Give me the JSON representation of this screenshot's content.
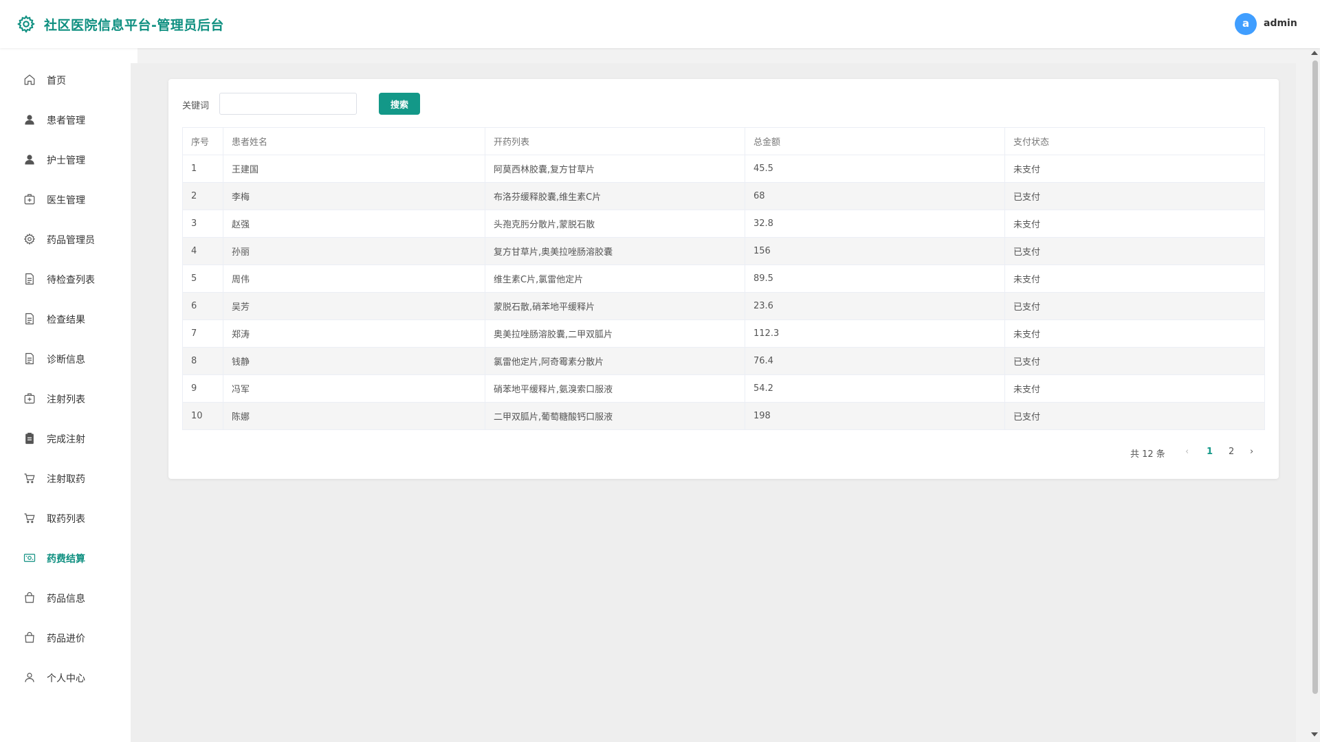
{
  "header": {
    "title": "社区医院信息平台-管理员后台",
    "avatar_letter": "a",
    "username": "admin"
  },
  "colors": {
    "accent": "#0e8f80",
    "button": "#139888",
    "avatar": "#409eff"
  },
  "sidebar": {
    "items": [
      {
        "label": "首页",
        "icon": "home-icon"
      },
      {
        "label": "患者管理",
        "icon": "user-filled-icon"
      },
      {
        "label": "护士管理",
        "icon": "user-filled-icon"
      },
      {
        "label": "医生管理",
        "icon": "first-aid-kit-icon"
      },
      {
        "label": "药品管理员",
        "icon": "gear-icon"
      },
      {
        "label": "待检查列表",
        "icon": "document-icon"
      },
      {
        "label": "检查结果",
        "icon": "document-icon"
      },
      {
        "label": "诊断信息",
        "icon": "document-icon"
      },
      {
        "label": "注射列表",
        "icon": "first-aid-kit-icon"
      },
      {
        "label": "完成注射",
        "icon": "clipboard-icon"
      },
      {
        "label": "注射取药",
        "icon": "cart-icon"
      },
      {
        "label": "取药列表",
        "icon": "cart-icon"
      },
      {
        "label": "药费结算",
        "icon": "money-icon",
        "active": true
      },
      {
        "label": "药品信息",
        "icon": "bag-icon"
      },
      {
        "label": "药品进价",
        "icon": "bag-icon"
      },
      {
        "label": "个人中心",
        "icon": "user-icon"
      }
    ]
  },
  "search": {
    "label": "关键词",
    "value": "",
    "placeholder": "",
    "button_label": "搜索"
  },
  "table": {
    "columns": [
      "序号",
      "患者姓名",
      "开药列表",
      "总金额",
      "支付状态"
    ],
    "rows": [
      [
        "1",
        "王建国",
        "阿莫西林胶囊,复方甘草片",
        "45.5",
        "未支付"
      ],
      [
        "2",
        "李梅",
        "布洛芬缓释胶囊,维生素C片",
        "68",
        "已支付"
      ],
      [
        "3",
        "赵强",
        "头孢克肟分散片,蒙脱石散",
        "32.8",
        "未支付"
      ],
      [
        "4",
        "孙丽",
        "复方甘草片,奥美拉唑肠溶胶囊",
        "156",
        "已支付"
      ],
      [
        "5",
        "周伟",
        "维生素C片,氯雷他定片",
        "89.5",
        "未支付"
      ],
      [
        "6",
        "吴芳",
        "蒙脱石散,硝苯地平缓释片",
        "23.6",
        "已支付"
      ],
      [
        "7",
        "郑涛",
        "奥美拉唑肠溶胶囊,二甲双胍片",
        "112.3",
        "未支付"
      ],
      [
        "8",
        "钱静",
        "氯雷他定片,阿奇霉素分散片",
        "76.4",
        "已支付"
      ],
      [
        "9",
        "冯军",
        "硝苯地平缓释片,氨溴索口服液",
        "54.2",
        "未支付"
      ],
      [
        "10",
        "陈娜",
        "二甲双胍片,葡萄糖酸钙口服液",
        "198",
        "已支付"
      ]
    ]
  },
  "pagination": {
    "total_text": "共 12 条",
    "prev": "‹",
    "pages": [
      "1",
      "2"
    ],
    "current": "1",
    "next": "›"
  }
}
